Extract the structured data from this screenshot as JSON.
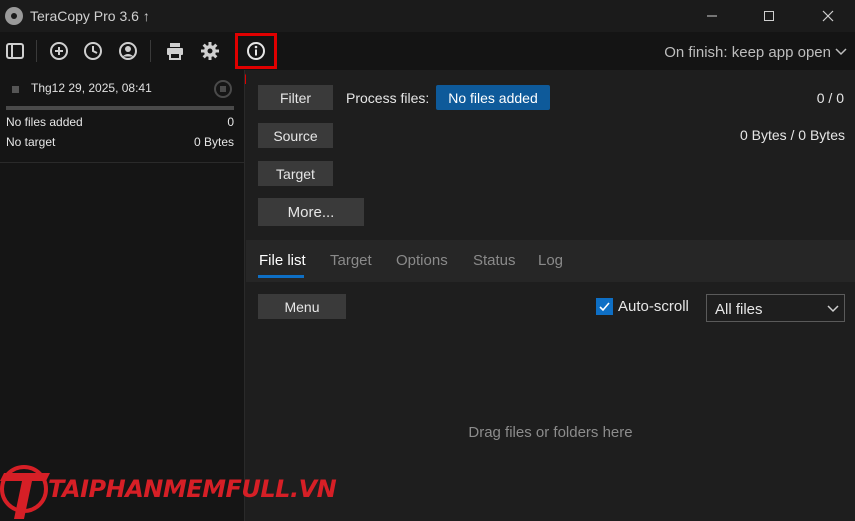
{
  "window": {
    "title": "TeraCopy Pro 3.6 ↑",
    "minimize_glyph": "—",
    "maximize_glyph": "☐",
    "close_glyph": "✕"
  },
  "toolbar": {
    "icons": [
      "panel-toggle-icon",
      "add-icon",
      "history-icon",
      "account-icon",
      "print-icon",
      "settings-icon",
      "info-icon"
    ],
    "on_finish": "On finish: keep app open"
  },
  "sidebar": {
    "job_date": "Thg12 29, 2025, 08:41",
    "files_label": "No files added",
    "files_count": "0",
    "target_label": "No target",
    "target_size": "0 Bytes"
  },
  "main": {
    "filter_label": "Filter",
    "process_label": "Process files:",
    "process_value": "No files added",
    "count": "0 / 0",
    "source_label": "Source",
    "bytes": "0 Bytes / 0 Bytes",
    "target_label": "Target",
    "more_label": "More...",
    "tabs": [
      {
        "label": "File list",
        "active": true
      },
      {
        "label": "Target",
        "active": false
      },
      {
        "label": "Options",
        "active": false
      },
      {
        "label": "Status",
        "active": false
      },
      {
        "label": "Log",
        "active": false
      }
    ],
    "menu_label": "Menu",
    "autoscroll_label": "Auto-scroll",
    "autoscroll_checked": true,
    "select_value": "All files",
    "drop_hint": "Drag files or folders here"
  },
  "colors": {
    "accent": "#0e6fc5",
    "no_files_button": "#0e5a9a",
    "highlight": "#e00000",
    "watermark": "#d61f26"
  },
  "watermark": {
    "text": "TAIPHANMEMFULL.VN"
  }
}
